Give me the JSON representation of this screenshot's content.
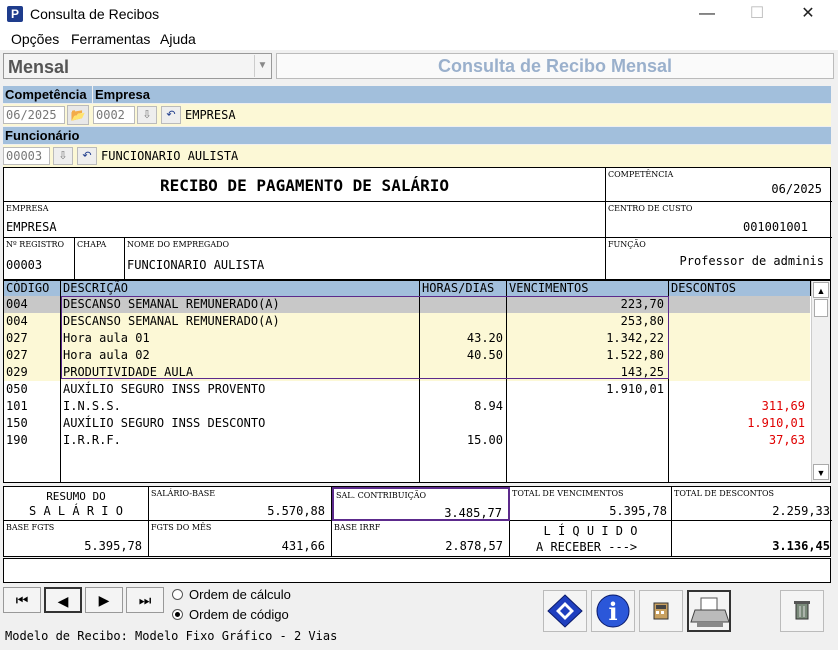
{
  "window": {
    "title": "Consulta de Recibos",
    "icon_letter": "P",
    "minimize": "—",
    "maximize": "☐",
    "close": "✕"
  },
  "menu": [
    "Opções",
    "Ferramentas",
    "Ajuda"
  ],
  "mode": {
    "value": "Mensal",
    "arrow": "▼"
  },
  "header_title": "Consulta de Recibo Mensal",
  "filters": {
    "competencia_label": "Competência",
    "competencia_value": "06/2025",
    "empresa_label": "Empresa",
    "empresa_code": "0002",
    "empresa_name": "EMPRESA",
    "funcionario_label": "Funcionário",
    "funcionario_code": "00003",
    "funcionario_name": "FUNCIONARIO  AULISTA"
  },
  "receipt": {
    "title": "RECIBO DE PAGAMENTO DE SALÁRIO",
    "competencia_label": "COMPETÊNCIA",
    "competencia_value": "06/2025",
    "empresa_label": "EMPRESA",
    "empresa_value": "EMPRESA",
    "centro_label": "CENTRO DE CUSTO",
    "centro_value": "001001001",
    "registro_label": "Nº REGISTRO",
    "registro_value": "00003",
    "chapa_label": "CHAPA",
    "chapa_value": "",
    "nome_label": "NOME DO EMPREGADO",
    "nome_value": "FUNCIONARIO  AULISTA",
    "funcao_label": "FUNÇÃO",
    "funcao_value": "Professor de adminis"
  },
  "grid": {
    "headers": [
      "CÓDIGO",
      "DESCRIÇÃO",
      "HORAS/DIAS",
      "VENCIMENTOS",
      "DESCONTOS"
    ],
    "rows": [
      {
        "codigo": "004",
        "descricao": "DESCANSO SEMANAL REMUNERADO(A)",
        "horas": "",
        "vencimentos": "223,70",
        "descontos": ""
      },
      {
        "codigo": "004",
        "descricao": "DESCANSO SEMANAL REMUNERADO(A)",
        "horas": "",
        "vencimentos": "253,80",
        "descontos": ""
      },
      {
        "codigo": "027",
        "descricao": "Hora aula 01",
        "horas": "43.20",
        "vencimentos": "1.342,22",
        "descontos": ""
      },
      {
        "codigo": "027",
        "descricao": "Hora aula 02",
        "horas": "40.50",
        "vencimentos": "1.522,80",
        "descontos": ""
      },
      {
        "codigo": "029",
        "descricao": "PRODUTIVIDADE AULA",
        "horas": "",
        "vencimentos": "143,25",
        "descontos": ""
      },
      {
        "codigo": "050",
        "descricao": "AUXÍLIO SEGURO  INSS PROVENTO",
        "horas": "",
        "vencimentos": "1.910,01",
        "descontos": ""
      },
      {
        "codigo": "101",
        "descricao": "I.N.S.S.",
        "horas": "8.94",
        "vencimentos": "",
        "descontos": "311,69"
      },
      {
        "codigo": "150",
        "descricao": "AUXÍLIO SEGURO  INSS DESCONTO",
        "horas": "",
        "vencimentos": "",
        "descontos": "1.910,01"
      },
      {
        "codigo": "190",
        "descricao": "I.R.R.F.",
        "horas": "15.00",
        "vencimentos": "",
        "descontos": "37,63"
      }
    ]
  },
  "summary": {
    "resumo_line1": "RESUMO DO",
    "resumo_line2": "S A L Á R I O",
    "salario_base_label": "SALÁRIO-BASE",
    "salario_base_value": "5.570,88",
    "sal_contrib_label": "SAL. CONTRIBUIÇÃO",
    "sal_contrib_value": "3.485,77",
    "total_venc_label": "TOTAL DE VENCIMENTOS",
    "total_venc_value": "5.395,78",
    "total_desc_label": "TOTAL DE DESCONTOS",
    "total_desc_value": "2.259,33",
    "base_fgts_label": "BASE FGTS",
    "base_fgts_value": "5.395,78",
    "fgts_mes_label": "FGTS DO MÊS",
    "fgts_mes_value": "431,66",
    "base_irrf_label": "BASE IRRF",
    "base_irrf_value": "2.878,57",
    "liquido_line1": "L Í Q U I D O",
    "liquido_line2": "A RECEBER --->",
    "liquido_value": "3.136,45"
  },
  "nav": {
    "first": "⏮",
    "prev": "◀",
    "next": "▶",
    "last": "⏭"
  },
  "order": {
    "calc_label": "Ordem de cálculo",
    "code_label": "Ordem de código"
  },
  "status": "Modelo de Recibo: Modelo Fixo Gráfico - 2 Vias",
  "colors": {
    "header_blue": "#a2bfdc",
    "row_yellow": "#fcf8d6",
    "row_selected": "#c8c8c8",
    "discount_red": "#e00000",
    "title_blue": "#9ab0cc"
  }
}
